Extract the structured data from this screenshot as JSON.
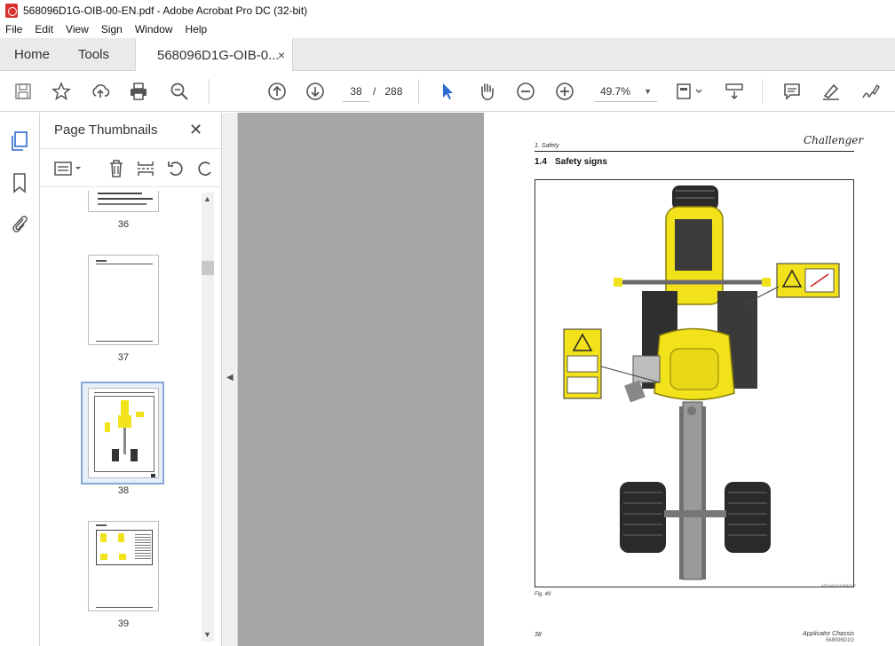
{
  "window": {
    "title": "568096D1G-OIB-00-EN.pdf - Adobe Acrobat Pro DC (32-bit)"
  },
  "menu": [
    "File",
    "Edit",
    "View",
    "Sign",
    "Window",
    "Help"
  ],
  "tabs": {
    "home": "Home",
    "tools": "Tools",
    "document": "568096D1G-OIB-0...",
    "close_glyph": "×"
  },
  "toolbar": {
    "current_page": "38",
    "page_separator": "/",
    "total_pages": "288",
    "zoom": "49.7%",
    "icons": [
      "save-icon",
      "bookmark-star-icon",
      "upload-icon",
      "print-icon",
      "zoom-search-icon",
      "page-up-icon",
      "page-down-icon",
      "select-cursor-icon",
      "hand-tool-icon",
      "zoom-out-icon",
      "zoom-in-icon",
      "page-fit-icon",
      "scroll-mode-icon",
      "comment-icon",
      "highlight-icon",
      "sign-icon"
    ]
  },
  "thumbnails_panel": {
    "title": "Page Thumbnails",
    "close_glyph": "✕",
    "pages": [
      {
        "label": "36"
      },
      {
        "label": "37"
      },
      {
        "label": "38",
        "selected": true
      },
      {
        "label": "39"
      }
    ]
  },
  "document_page": {
    "header_small": "1. Safety",
    "brand": "Challenger",
    "section_number": "1.4",
    "section_title": "Safety signs",
    "figure_caption": "Fig. 49",
    "figure_id": "APEUA019405M2009",
    "footer_page": "38",
    "footer_title": "Applicator Chassis",
    "footer_code": "568096D1G"
  },
  "colors": {
    "machine_yellow": "#f2e21b",
    "accent_blue": "#2e6bd1",
    "acrobat_red": "#d6322f"
  }
}
